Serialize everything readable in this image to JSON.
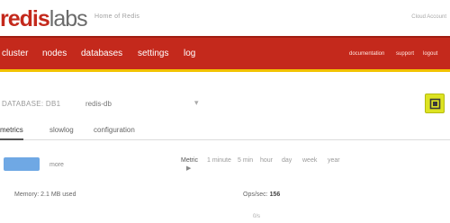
{
  "brand": {
    "logo_part1": "redis",
    "logo_part2": "labs",
    "tagline": "Home of Redis",
    "top_right": "Cloud Account"
  },
  "nav": {
    "items": [
      "cluster",
      "nodes",
      "databases",
      "settings",
      "log"
    ],
    "right_items": [
      "documentation",
      "support",
      "logout"
    ]
  },
  "subheader": {
    "title": "DATABASE: DB1",
    "field": "redis-db",
    "caret": "▾"
  },
  "tabs": [
    "metrics",
    "slowlog",
    "configuration"
  ],
  "toolbar": {
    "time_label": "Metric",
    "time_options": [
      "1 minute",
      "5 min",
      "hour",
      "day",
      "week",
      "year"
    ],
    "gray_link": "more"
  },
  "stats": {
    "left": "Memory: 2.1 MB used",
    "right_label": "Ops/sec: ",
    "right_value": "156",
    "below_right": "0/s"
  },
  "colors": {
    "brand_red": "#c4291c",
    "accent_yellow": "#f2c200",
    "refresh_green": "#dde322",
    "primary_blue": "#6fa8e4"
  }
}
